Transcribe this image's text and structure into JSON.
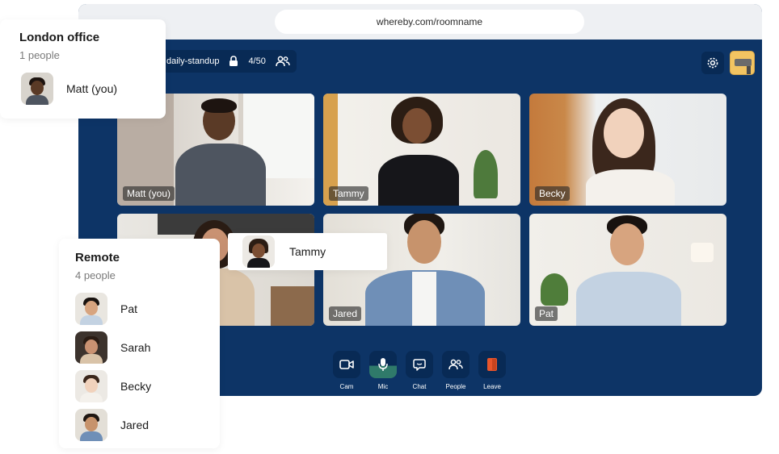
{
  "browser": {
    "url": "whereby.com/roomname"
  },
  "room": {
    "name": "daily-standup",
    "count": "4/50"
  },
  "tiles": [
    {
      "name": "Matt (you)"
    },
    {
      "name": "Tammy"
    },
    {
      "name": "Becky"
    },
    {
      "name": ""
    },
    {
      "name": "Jared"
    },
    {
      "name": "Pat"
    }
  ],
  "toolbar": {
    "cam": "Cam",
    "mic": "Mic",
    "chat": "Chat",
    "people": "People",
    "leave": "Leave"
  },
  "london": {
    "title": "London office",
    "subtitle": "1 people",
    "member": "Matt (you)"
  },
  "remote": {
    "title": "Remote",
    "subtitle": "4 people",
    "members": [
      "Pat",
      "Sarah",
      "Becky",
      "Jared"
    ]
  },
  "drag": {
    "name": "Tammy"
  },
  "colors": {
    "room_bg": "#0d3466",
    "control_bg": "#082a55",
    "mic_active": "#2f7a6a",
    "leave": "#e8552b"
  },
  "icons": [
    "lock-icon",
    "people-icon",
    "gear-icon",
    "camera-icon",
    "microphone-icon",
    "chat-icon",
    "people-icon",
    "leave-icon"
  ]
}
